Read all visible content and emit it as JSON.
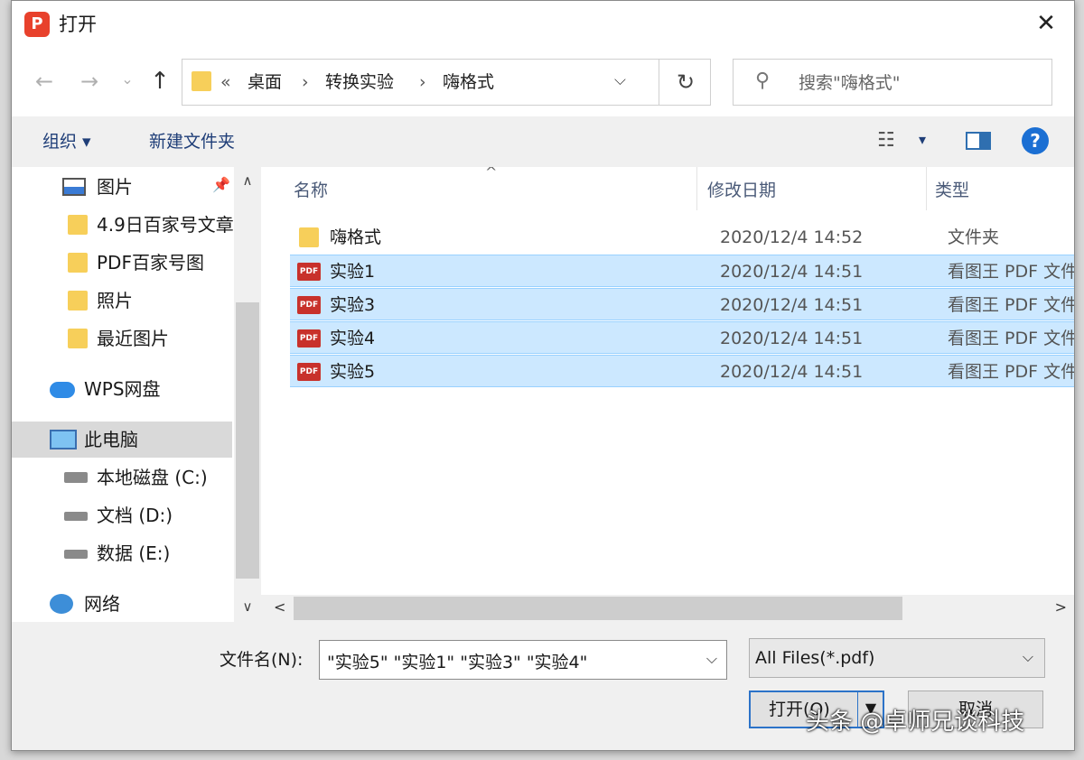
{
  "window": {
    "title": "打开",
    "app_icon_letter": "P",
    "close_glyph": "✕"
  },
  "nav": {
    "back_glyph": "←",
    "forward_glyph": "→",
    "recent_glyph": "⌄",
    "up_glyph": "↑",
    "address": {
      "overflow": "«",
      "separator": "›",
      "crumbs": [
        "桌面",
        "转换实验",
        "嗨格式"
      ],
      "dropdown_glyph": "⌵",
      "refresh_glyph": "↻"
    },
    "search": {
      "placeholder": "搜索\"嗨格式\"",
      "icon_glyph": "⚲"
    }
  },
  "toolbar": {
    "organize_label": "组织 ▾",
    "new_folder_label": "新建文件夹",
    "view_glyph": "☷",
    "view_dd_glyph": "▾",
    "help_glyph": "?"
  },
  "sidebar": {
    "items": [
      {
        "label": "图片",
        "icon": "pictures-icon",
        "pinned": true,
        "pin_glyph": "📌"
      },
      {
        "label": "4.9日百家号文章",
        "icon": "folder-icon"
      },
      {
        "label": "PDF百家号图",
        "icon": "folder-icon"
      },
      {
        "label": "照片",
        "icon": "folder-icon"
      },
      {
        "label": "最近图片",
        "icon": "folder-icon"
      },
      {
        "label": "WPS网盘",
        "icon": "cloud-icon"
      },
      {
        "label": "此电脑",
        "icon": "computer-icon",
        "selected": true
      },
      {
        "label": "本地磁盘 (C:)",
        "icon": "drive-icon"
      },
      {
        "label": "文档 (D:)",
        "icon": "drive-icon"
      },
      {
        "label": "数据 (E:)",
        "icon": "drive-icon"
      },
      {
        "label": "网络",
        "icon": "network-icon"
      }
    ],
    "scroll_up_glyph": "∧",
    "scroll_down_glyph": "∨"
  },
  "filelist": {
    "columns": [
      "名称",
      "修改日期",
      "类型"
    ],
    "sort_glyph": "^",
    "rows": [
      {
        "name": "嗨格式",
        "date": "2020/12/4 14:52",
        "type": "文件夹",
        "icon": "folder-icon",
        "selected": false
      },
      {
        "name": "实验1",
        "date": "2020/12/4 14:51",
        "type": "看图王 PDF 文件",
        "icon": "pdf-icon",
        "selected": true
      },
      {
        "name": "实验3",
        "date": "2020/12/4 14:51",
        "type": "看图王 PDF 文件",
        "icon": "pdf-icon",
        "selected": true
      },
      {
        "name": "实验4",
        "date": "2020/12/4 14:51",
        "type": "看图王 PDF 文件",
        "icon": "pdf-icon",
        "selected": true
      },
      {
        "name": "实验5",
        "date": "2020/12/4 14:51",
        "type": "看图王 PDF 文件",
        "icon": "pdf-icon",
        "selected": true
      }
    ],
    "pdf_badge": "PDF",
    "hscroll_left_glyph": "<",
    "hscroll_right_glyph": ">"
  },
  "footer": {
    "filename_label": "文件名(N):",
    "filename_value": "\"实验5\" \"实验1\" \"实验3\" \"实验4\"",
    "filename_dd_glyph": "⌵",
    "filter_value": "All Files(*.pdf)",
    "filter_dd_glyph": "⌵",
    "open_label": "打开(O)",
    "open_split_glyph": "▼",
    "cancel_label": "取消"
  },
  "watermark": "头条 @卓师兄谈科技"
}
